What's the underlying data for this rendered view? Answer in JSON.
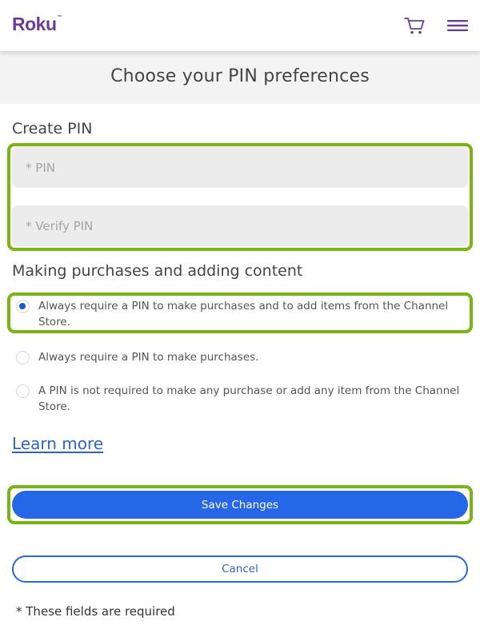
{
  "header": {
    "logo_text": "Roku",
    "logo_trademark": "™",
    "cart_icon": "shopping-cart-icon",
    "menu_icon": "hamburger-menu-icon"
  },
  "page": {
    "title": "Choose your PIN preferences"
  },
  "create_pin": {
    "heading": "Create PIN",
    "pin_placeholder": "* PIN",
    "pin_value": "",
    "verify_placeholder": "* Verify PIN",
    "verify_value": ""
  },
  "purchases": {
    "heading": "Making purchases and adding content",
    "options": [
      {
        "label": "Always require a PIN to make purchases and to add items from the Channel Store.",
        "selected": true
      },
      {
        "label": "Always require a PIN to make purchases.",
        "selected": false
      },
      {
        "label": "A PIN is not required to make any purchase or add any item from the Channel Store.",
        "selected": false
      }
    ]
  },
  "links": {
    "learn_more": "Learn more"
  },
  "actions": {
    "save_label": "Save Changes",
    "cancel_label": "Cancel"
  },
  "footer": {
    "required_note": "* These fields are required"
  },
  "colors": {
    "brand_purple": "#6c3c97",
    "primary_blue": "#2667e8",
    "highlight_green": "#78b413"
  }
}
